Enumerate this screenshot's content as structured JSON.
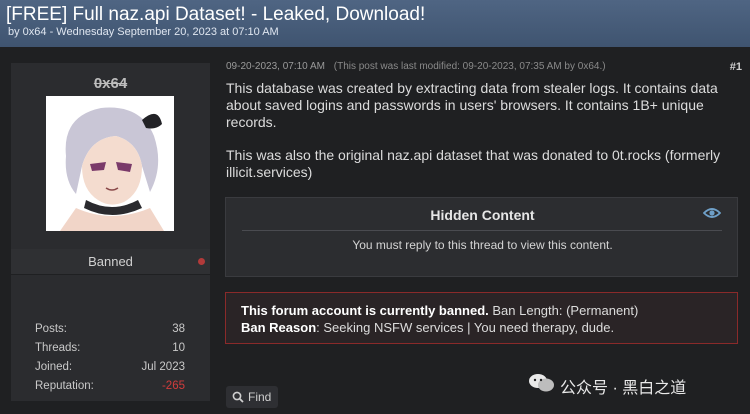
{
  "thread": {
    "title": "[FREE] Full naz.api Dataset! - Leaked, Download!",
    "byline": "by 0x64 - Wednesday September 20, 2023 at 07:10 AM"
  },
  "author": {
    "username": "0x64",
    "usertitle": "Banned",
    "status_color": "#b23a3a",
    "stats": [
      {
        "label": "Posts:",
        "value": "38"
      },
      {
        "label": "Threads:",
        "value": "10"
      },
      {
        "label": "Joined:",
        "value": "Jul 2023"
      },
      {
        "label": "Reputation:",
        "value": "-265"
      }
    ]
  },
  "post": {
    "date": "09-20-2023, 07:10 AM",
    "edited_note": "(This post was last modified: 09-20-2023, 07:35 AM by 0x64.)",
    "number": "#1",
    "paragraph_1": "This database was created by extracting data from stealer logs. It contains data about saved logins and passwords in users' browsers. It contains 1B+ unique records.",
    "paragraph_2": "This was also the original naz.api dataset that was donated to 0t.rocks (formerly illicit.services)"
  },
  "hidden_content": {
    "title": "Hidden Content",
    "message": "You must reply to this thread to view this content.",
    "icon": "eye-icon"
  },
  "ban_notice": {
    "line1_bold": "This forum account is currently banned.",
    "line1_rest": " Ban Length: (Permanent)",
    "line2_bold": "Ban Reason",
    "line2_rest": ": Seeking NSFW services | You need therapy, dude.",
    "border_color": "#8a2a2a"
  },
  "actions": {
    "find_label": "Find",
    "find_icon": "search-icon"
  },
  "watermark": {
    "text": "公众号 · 黑白之道",
    "icon": "wechat-icon"
  },
  "colors": {
    "header": "#4a5f7d",
    "background": "#1f2022",
    "negative": "#d23c3c"
  }
}
